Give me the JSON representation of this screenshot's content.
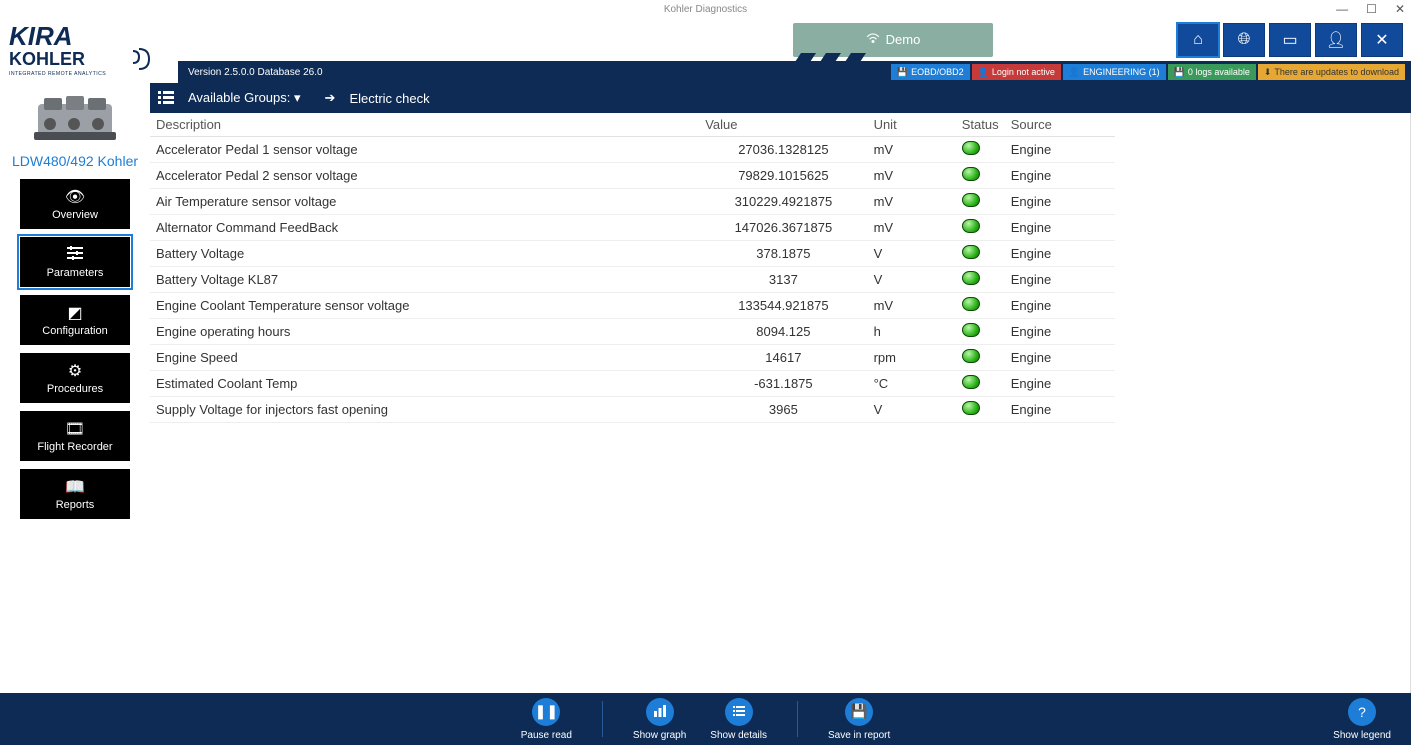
{
  "window": {
    "title": "Kohler Diagnostics",
    "min": "—",
    "max": "☐",
    "close": "✕"
  },
  "brand": {
    "line1": "KIRA",
    "line2": "KOHLER",
    "tagline": "INTEGRATED REMOTE ANALYTICS"
  },
  "header": {
    "version": "Version 2.5.0.0 Database 26.0",
    "demo": "Demo",
    "badges": {
      "eobd": "EOBD/OBD2",
      "login": "Login not active",
      "engineering": "ENGINEERING (1)",
      "logs": "0 logs available",
      "updates": "There are updates to download"
    }
  },
  "engine": {
    "label": "LDW480/492 Kohler"
  },
  "nav": {
    "overview": "Overview",
    "parameters": "Parameters",
    "configuration": "Configuration",
    "procedures": "Procedures",
    "flight_recorder": "Flight Recorder",
    "reports": "Reports"
  },
  "groups": {
    "label": "Available Groups:",
    "current": "Electric check"
  },
  "table": {
    "headers": {
      "description": "Description",
      "value": "Value",
      "unit": "Unit",
      "status": "Status",
      "source": "Source"
    },
    "rows": [
      {
        "desc": "Accelerator Pedal 1 sensor voltage",
        "value": "27036.1328125",
        "unit": "mV",
        "source": "Engine"
      },
      {
        "desc": "Accelerator Pedal 2 sensor voltage",
        "value": "79829.1015625",
        "unit": "mV",
        "source": "Engine"
      },
      {
        "desc": "Air Temperature sensor voltage",
        "value": "310229.4921875",
        "unit": "mV",
        "source": "Engine"
      },
      {
        "desc": "Alternator Command FeedBack",
        "value": "147026.3671875",
        "unit": "mV",
        "source": "Engine"
      },
      {
        "desc": "Battery Voltage",
        "value": "378.1875",
        "unit": "V",
        "source": "Engine"
      },
      {
        "desc": "Battery Voltage KL87",
        "value": "3137",
        "unit": "V",
        "source": "Engine"
      },
      {
        "desc": "Engine Coolant Temperature sensor voltage",
        "value": "133544.921875",
        "unit": "mV",
        "source": "Engine"
      },
      {
        "desc": "Engine operating hours",
        "value": "8094.125",
        "unit": "h",
        "source": "Engine"
      },
      {
        "desc": "Engine Speed",
        "value": "14617",
        "unit": "rpm",
        "source": "Engine"
      },
      {
        "desc": "Estimated Coolant Temp",
        "value": "-631.1875",
        "unit": "°C",
        "source": "Engine"
      },
      {
        "desc": "Supply Voltage for injectors fast opening",
        "value": "3965",
        "unit": "V",
        "source": "Engine"
      }
    ]
  },
  "footer": {
    "pause": "Pause read",
    "graph": "Show graph",
    "details": "Show details",
    "save": "Save in report",
    "legend": "Show legend"
  }
}
